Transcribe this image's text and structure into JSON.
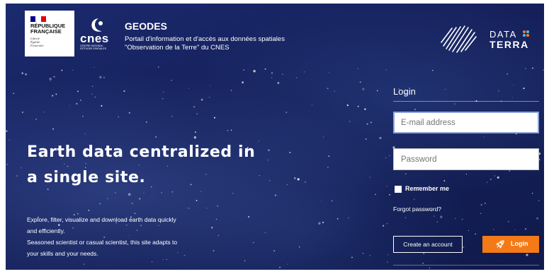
{
  "header": {
    "republique_logo": {
      "name_lines": "RÉPUBLIQUE\nFRANÇAISE",
      "motto_lines": "Liberté\nÉgalité\nFraternité"
    },
    "cnes_logo": {
      "word": "cnes",
      "subtitle": "CENTRE NATIONAL\nD'ÉTUDES SPATIALES"
    },
    "app_title": "GEODES",
    "app_description_line1": "Portail d'information et d'accès aux données spatiales",
    "app_description_line2": "\"Observation de la Terre\" du CNES",
    "dataterra_logo": {
      "line1": "DATA",
      "line2": "TERRA"
    }
  },
  "hero": {
    "headline_line1": "Earth data centralized in",
    "headline_line2": "a single site.",
    "body_lines": [
      "Explore, filter, visualize and download earth data quickly",
      "and efficiently.",
      "Seasoned scientist or casual scientist, this site adapts to",
      "your skills and your needs."
    ]
  },
  "login": {
    "title": "Login",
    "email_placeholder": "E-mail address",
    "email_value": "",
    "password_placeholder": "Password",
    "password_value": "",
    "remember_label": "Remember me",
    "remember_checked": false,
    "forgot_label": "Forgot password?",
    "create_account_label": "Create an account",
    "login_button_label": "Login"
  },
  "icons": {
    "flag": "french-flag-icon",
    "cnes": "cnes-logo-icon",
    "dataterra": "dataterra-logo-icon",
    "rocket": "rocket-icon"
  },
  "colors": {
    "background": "#15205a",
    "login_button": "#f47a17",
    "field_focus_border": "#8fa4d6",
    "text": "#ffffff",
    "flag_blue": "#000091",
    "flag_white": "#ffffff",
    "flag_red": "#e1000f"
  }
}
